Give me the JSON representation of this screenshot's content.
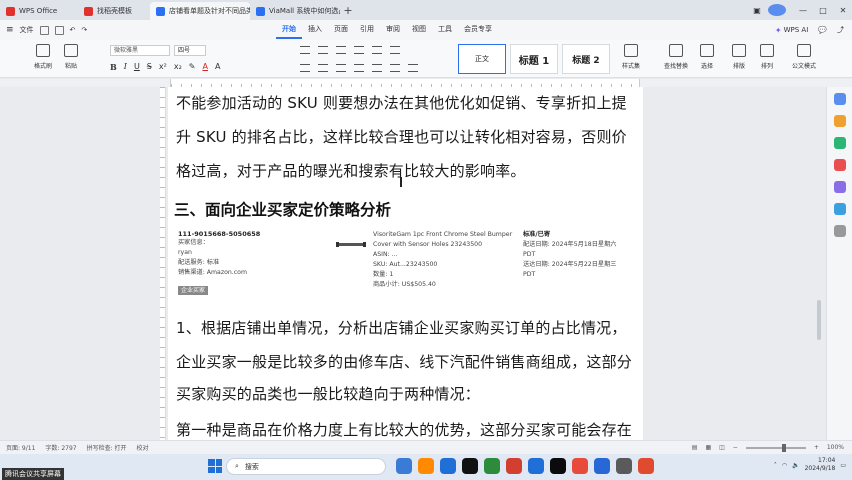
{
  "tabs": [
    {
      "label": "WPS Office",
      "color": "#e0322c"
    },
    {
      "label": "找稻壳模板",
      "color": "#e0322c"
    },
    {
      "label": "店铺看单题及针对不同品类",
      "color": "#2b6ff3"
    },
    {
      "label": "ViaMall 系统中如何选品.docx",
      "color": "#2b6ff3"
    }
  ],
  "menubar": {
    "file": "文件",
    "items": [
      "开始",
      "插入",
      "页面",
      "引用",
      "审阅",
      "视图",
      "工具",
      "会员专享"
    ],
    "active": "开始",
    "wps_ai": "WPS AI",
    "right_icons": [
      "comment-icon",
      "share-icon"
    ]
  },
  "ribbon": {
    "left_buttons": [
      "格式刷",
      "粘贴"
    ],
    "font_name": "微软雅黑",
    "font_size": "四号",
    "styles": [
      "正文",
      "标题 1",
      "标题 2"
    ],
    "right_buttons": [
      "样式集",
      "查找替换",
      "选择",
      "排版",
      "排列",
      "公文模式"
    ]
  },
  "document": {
    "lines": [
      "不能参加活动的 SKU 则要想办法在其他优化如促销、专享折扣上提",
      "升 SKU 的排名占比，这样比较合理也可以让转化相对容易，否则价",
      "格过高，对于产品的曝光和搜索有比较大的影响率。"
    ],
    "heading": "三、面向企业买家定价策略分析",
    "order": {
      "order_id": "111-9015668-5050658",
      "left_lines": [
        "买家信息：",
        "ryan",
        "配送服务: 标准",
        "销售渠道: Amazon.com"
      ],
      "badge": "企业买家",
      "product_lines": [
        "VisoriteGam 1pc Front Chrome Steel Bumper",
        "Cover with Sensor Holes 23243500",
        "ASIN: ...",
        "SKU: Aut...23243500",
        "数量: 1",
        "商品小计: US$505.40"
      ],
      "status": "标准/已寄",
      "date_lines": [
        "配送日期: 2024年5月18日星期六 PDT",
        "送达日期: 2024年5月22日星期三 PDT"
      ]
    },
    "after_lines": [
      "1、根据店铺出单情况，分析出店铺企业买家购买订单的占比情况，",
      "企业买家一般是比较多的由修车店、线下汽配件销售商组成，这部分",
      "买家购买的品类也一般比较趋向于两种情况：",
      "第一种是商品在价格力度上有比较大的优势，这部分买家可能会存在"
    ]
  },
  "statusbar": {
    "page": "页面: 9/11",
    "words": "字数: 2797",
    "spell": "拼写检查: 打开",
    "proof": "校对",
    "zoom": "100%"
  },
  "taskbar": {
    "share_label": "腾讯会议共享屏幕",
    "search": "搜索",
    "time": "17:04",
    "date": "2024/9/18",
    "app_colors": [
      "#3a7bd5",
      "#ff8a00",
      "#1f6fd6",
      "#111111",
      "#2d8c3c",
      "#d23f31",
      "#1f6fd6",
      "#0b0b0b",
      "#e64b3c",
      "#2867d6",
      "#5a5a5a",
      "#e04a2f"
    ]
  }
}
